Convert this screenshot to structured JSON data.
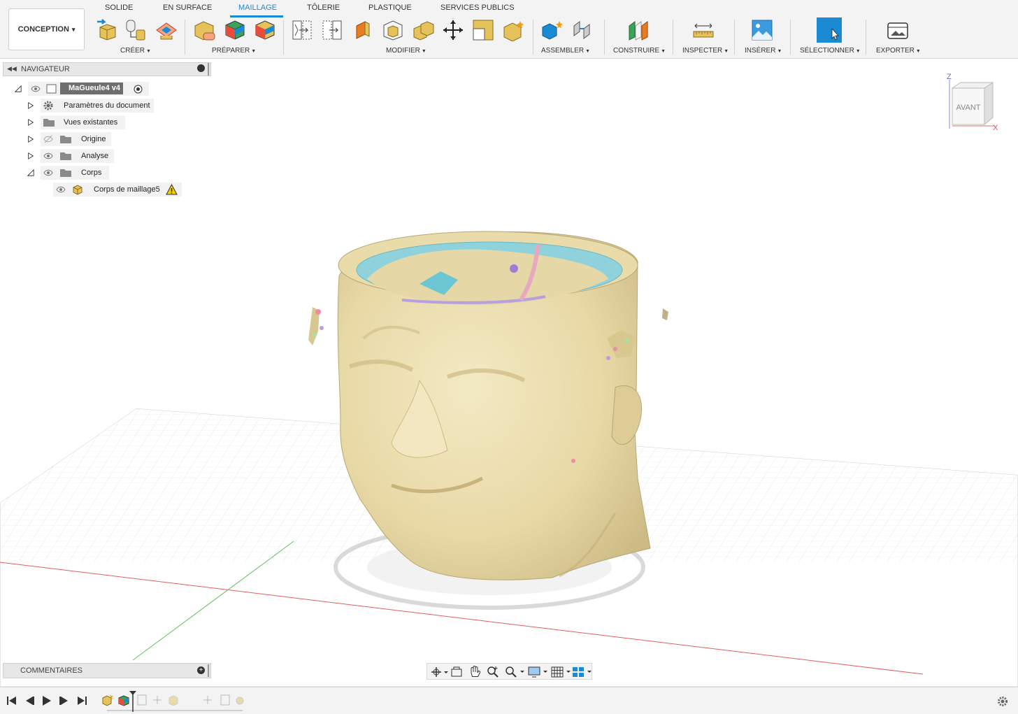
{
  "workspace": {
    "label": "CONCEPTION",
    "caret": "▾"
  },
  "tabs": [
    {
      "label": "SOLIDE"
    },
    {
      "label": "EN SURFACE"
    },
    {
      "label": "MAILLAGE"
    },
    {
      "label": "TÔLERIE"
    },
    {
      "label": "PLASTIQUE"
    },
    {
      "label": "SERVICES PUBLICS"
    }
  ],
  "groups": [
    {
      "label": "CRÉER"
    },
    {
      "label": "PRÉPARER"
    },
    {
      "label": "MODIFIER"
    },
    {
      "label": "ASSEMBLER"
    },
    {
      "label": "CONSTRUIRE"
    },
    {
      "label": "INSPECTER"
    },
    {
      "label": "INSÉRER"
    },
    {
      "label": "SÉLECTIONNER"
    },
    {
      "label": "EXPORTER"
    }
  ],
  "browser": {
    "title": "NAVIGATEUR",
    "root": "MaGueule4 v4",
    "items": [
      {
        "label": "Paramètres du document",
        "icon": "gear-icon"
      },
      {
        "label": "Vues existantes",
        "icon": "folder-icon"
      },
      {
        "label": "Origine",
        "icon": "folder-icon"
      },
      {
        "label": "Analyse",
        "icon": "folder-icon"
      },
      {
        "label": "Corps",
        "icon": "folder-icon"
      },
      {
        "label": "Corps de maillage5",
        "icon": "mesh-body-icon"
      }
    ]
  },
  "viewcube": {
    "face": "AVANT",
    "axis_z": "Z",
    "axis_x": "X"
  },
  "comments": {
    "label": "COMMENTAIRES"
  },
  "colors": {
    "accent": "#1a8ad3",
    "mesh": "#e9dcaa",
    "grid": "#e2e2e2"
  }
}
